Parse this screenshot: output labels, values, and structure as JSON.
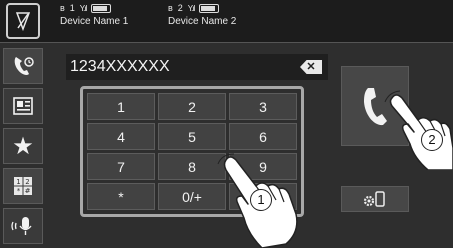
{
  "status_bar": {
    "device1": {
      "index": "1",
      "name": "Device Name 1"
    },
    "device2": {
      "index": "2",
      "name": "Device Name 2"
    }
  },
  "sidebar": {
    "items": [
      {
        "icon": "phone-history-icon"
      },
      {
        "icon": "phonebook-icon"
      },
      {
        "icon": "star-icon"
      },
      {
        "icon": "keypad-icon"
      },
      {
        "icon": "voice-mic-icon"
      }
    ]
  },
  "dial": {
    "number": "1234XXXXXX"
  },
  "keypad": {
    "keys": [
      "1",
      "2",
      "3",
      "4",
      "5",
      "6",
      "7",
      "8",
      "9",
      "*",
      "0/+",
      "#"
    ]
  },
  "callouts": {
    "first": "1",
    "second": "2"
  }
}
